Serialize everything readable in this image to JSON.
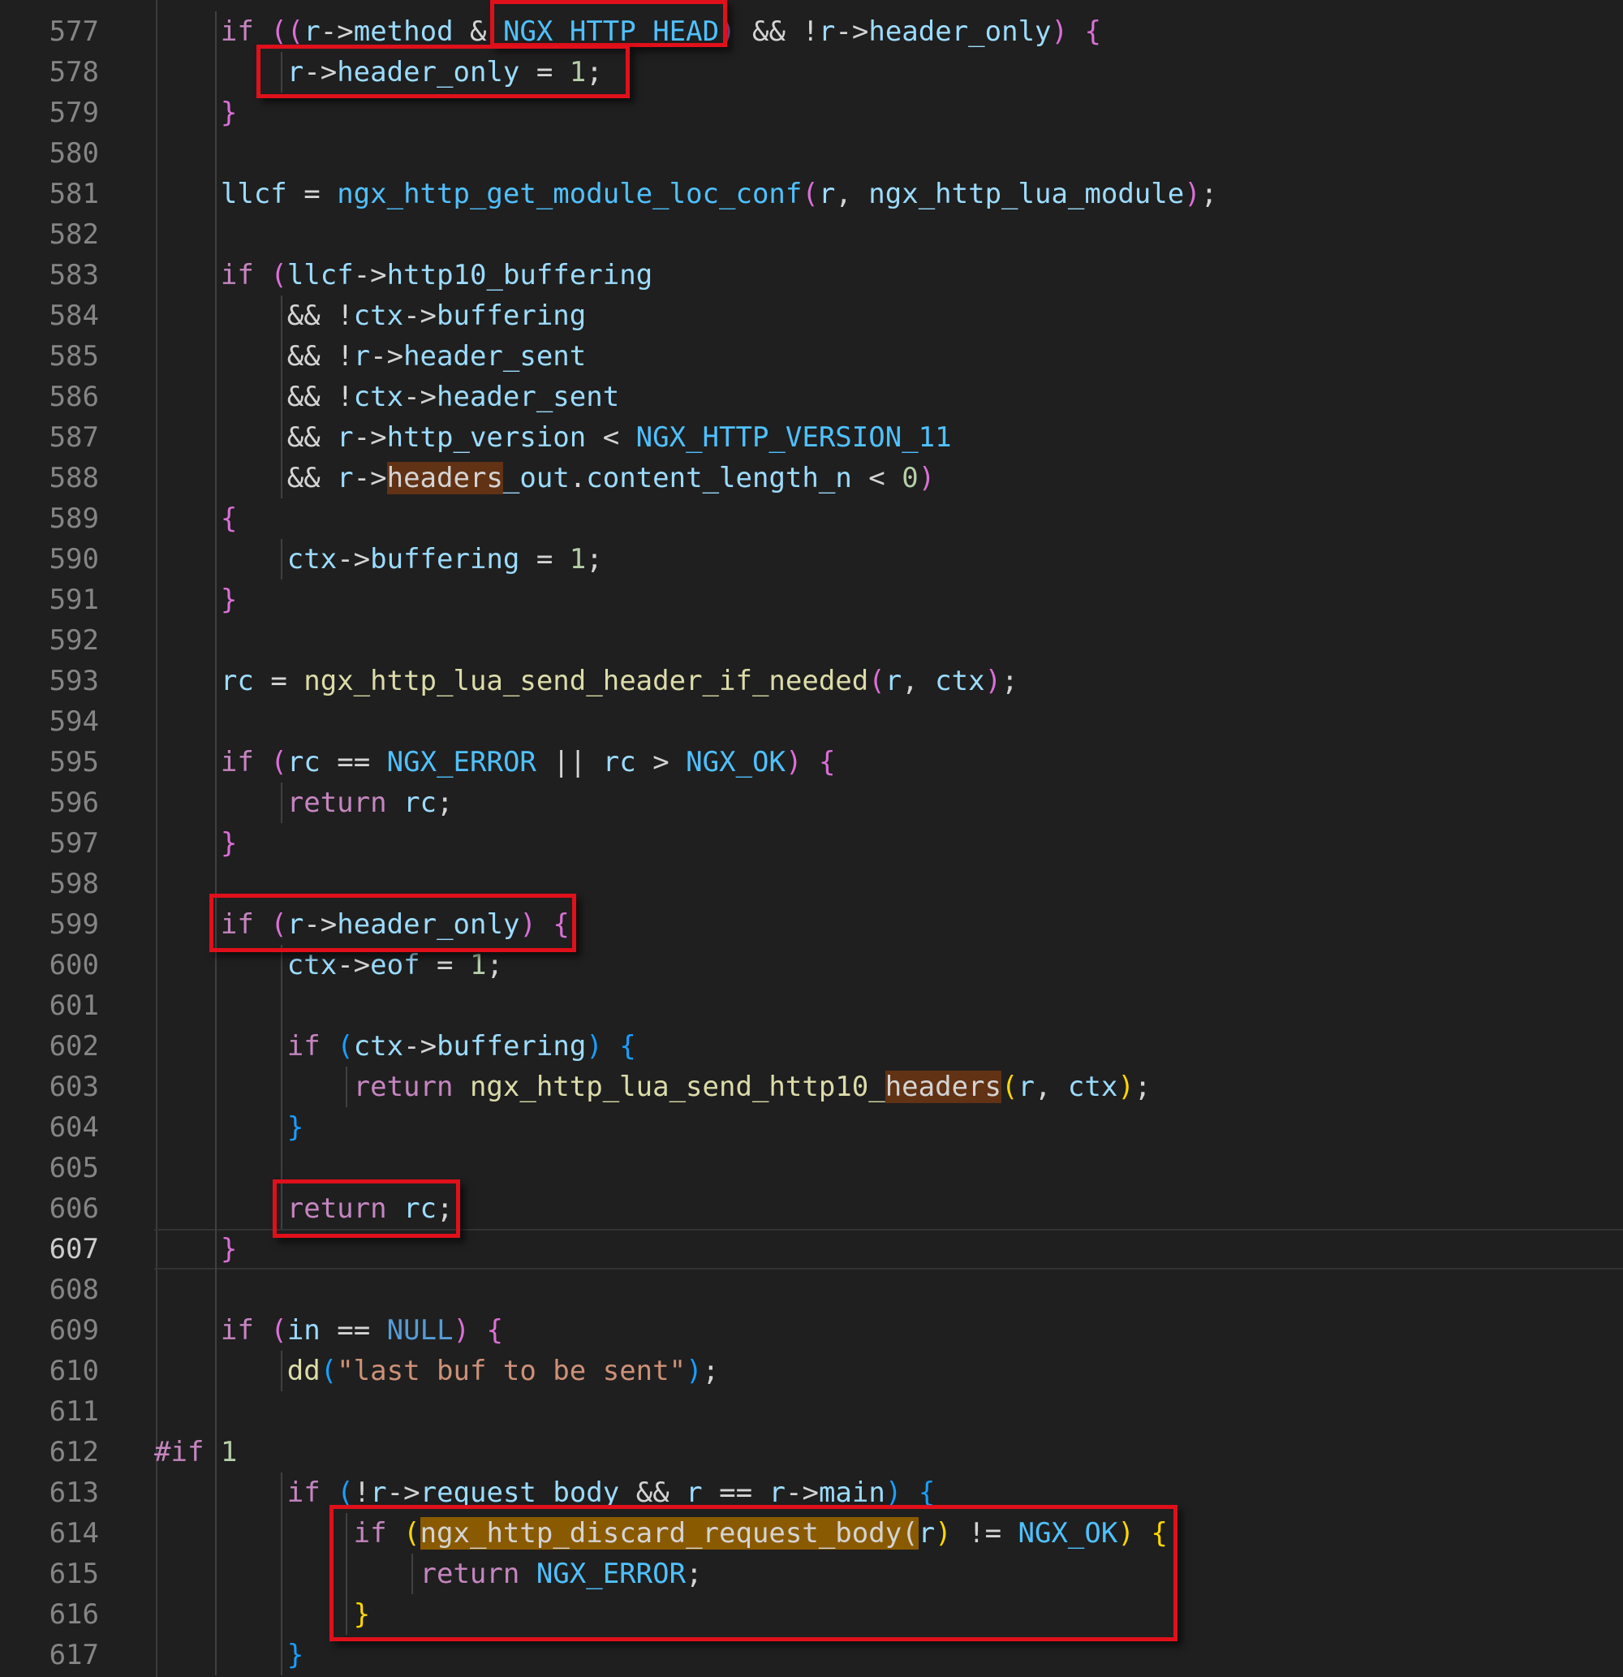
{
  "editor": {
    "language": "c",
    "active_line": "607",
    "lines": [
      {
        "n": "577",
        "tokens": [
          [
            "    ",
            ""
          ],
          [
            "if",
            "kw"
          ],
          [
            " ",
            ""
          ],
          [
            "((",
            "p1"
          ],
          [
            "r",
            "var"
          ],
          [
            "->",
            "op"
          ],
          [
            "method",
            "var"
          ],
          [
            " & ",
            ""
          ],
          [
            "NGX_HTTP_HEAD",
            "mac"
          ],
          [
            ")",
            "p1"
          ],
          [
            " && !",
            ""
          ],
          [
            "r",
            "var"
          ],
          [
            "->",
            "op"
          ],
          [
            "header_only",
            "var"
          ],
          [
            ")",
            "p1"
          ],
          [
            " ",
            ""
          ],
          [
            "{",
            "p1"
          ]
        ]
      },
      {
        "n": "578",
        "tokens": [
          [
            "        ",
            ""
          ],
          [
            "r",
            "var"
          ],
          [
            "->",
            "op"
          ],
          [
            "header_only",
            "var"
          ],
          [
            " = ",
            ""
          ],
          [
            "1",
            "num"
          ],
          [
            ";",
            ""
          ]
        ]
      },
      {
        "n": "579",
        "tokens": [
          [
            "    ",
            ""
          ],
          [
            "}",
            "p1"
          ]
        ]
      },
      {
        "n": "580",
        "tokens": []
      },
      {
        "n": "581",
        "tokens": [
          [
            "    ",
            ""
          ],
          [
            "llcf",
            "var"
          ],
          [
            " = ",
            ""
          ],
          [
            "ngx_http_get_module_loc_conf",
            "mac"
          ],
          [
            "(",
            "p1"
          ],
          [
            "r",
            "var"
          ],
          [
            ", ",
            ""
          ],
          [
            "ngx_http_lua_module",
            "var"
          ],
          [
            ")",
            "p1"
          ],
          [
            ";",
            ""
          ]
        ]
      },
      {
        "n": "582",
        "tokens": []
      },
      {
        "n": "583",
        "tokens": [
          [
            "    ",
            ""
          ],
          [
            "if",
            "kw"
          ],
          [
            " ",
            ""
          ],
          [
            "(",
            "p1"
          ],
          [
            "llcf",
            "var"
          ],
          [
            "->",
            "op"
          ],
          [
            "http10_buffering",
            "var"
          ]
        ]
      },
      {
        "n": "584",
        "tokens": [
          [
            "        && !",
            ""
          ],
          [
            "ctx",
            "var"
          ],
          [
            "->",
            "op"
          ],
          [
            "buffering",
            "var"
          ]
        ]
      },
      {
        "n": "585",
        "tokens": [
          [
            "        && !",
            ""
          ],
          [
            "r",
            "var"
          ],
          [
            "->",
            "op"
          ],
          [
            "header_sent",
            "var"
          ]
        ]
      },
      {
        "n": "586",
        "tokens": [
          [
            "        && !",
            ""
          ],
          [
            "ctx",
            "var"
          ],
          [
            "->",
            "op"
          ],
          [
            "header_sent",
            "var"
          ]
        ]
      },
      {
        "n": "587",
        "tokens": [
          [
            "        && ",
            ""
          ],
          [
            "r",
            "var"
          ],
          [
            "->",
            "op"
          ],
          [
            "http_version",
            "var"
          ],
          [
            " < ",
            ""
          ],
          [
            "NGX_HTTP_VERSION_11",
            "mac"
          ]
        ]
      },
      {
        "n": "588",
        "tokens": [
          [
            "        && ",
            ""
          ],
          [
            "r",
            "var"
          ],
          [
            "->",
            "op"
          ],
          [
            "headers",
            "mark"
          ],
          [
            "_out",
            "var"
          ],
          [
            ".",
            ""
          ],
          [
            "content_length_n",
            "var"
          ],
          [
            " < ",
            ""
          ],
          [
            "0",
            "num"
          ],
          [
            ")",
            "p1"
          ]
        ]
      },
      {
        "n": "589",
        "tokens": [
          [
            "    ",
            ""
          ],
          [
            "{",
            "p1"
          ]
        ]
      },
      {
        "n": "590",
        "tokens": [
          [
            "        ",
            ""
          ],
          [
            "ctx",
            "var"
          ],
          [
            "->",
            "op"
          ],
          [
            "buffering",
            "var"
          ],
          [
            " = ",
            ""
          ],
          [
            "1",
            "num"
          ],
          [
            ";",
            ""
          ]
        ]
      },
      {
        "n": "591",
        "tokens": [
          [
            "    ",
            ""
          ],
          [
            "}",
            "p1"
          ]
        ]
      },
      {
        "n": "592",
        "tokens": []
      },
      {
        "n": "593",
        "tokens": [
          [
            "    ",
            ""
          ],
          [
            "rc",
            "var"
          ],
          [
            " = ",
            ""
          ],
          [
            "ngx_http_lua_send_header_if_needed",
            "fn"
          ],
          [
            "(",
            "p1"
          ],
          [
            "r",
            "var"
          ],
          [
            ", ",
            ""
          ],
          [
            "ctx",
            "var"
          ],
          [
            ")",
            "p1"
          ],
          [
            ";",
            ""
          ]
        ]
      },
      {
        "n": "594",
        "tokens": []
      },
      {
        "n": "595",
        "tokens": [
          [
            "    ",
            ""
          ],
          [
            "if",
            "kw"
          ],
          [
            " ",
            ""
          ],
          [
            "(",
            "p1"
          ],
          [
            "rc",
            "var"
          ],
          [
            " == ",
            ""
          ],
          [
            "NGX_ERROR",
            "mac"
          ],
          [
            " || ",
            ""
          ],
          [
            "rc",
            "var"
          ],
          [
            " > ",
            ""
          ],
          [
            "NGX_OK",
            "mac"
          ],
          [
            ")",
            "p1"
          ],
          [
            " ",
            ""
          ],
          [
            "{",
            "p1"
          ]
        ]
      },
      {
        "n": "596",
        "tokens": [
          [
            "        ",
            ""
          ],
          [
            "return",
            "kw"
          ],
          [
            " ",
            ""
          ],
          [
            "rc",
            "var"
          ],
          [
            ";",
            ""
          ]
        ]
      },
      {
        "n": "597",
        "tokens": [
          [
            "    ",
            ""
          ],
          [
            "}",
            "p1"
          ]
        ]
      },
      {
        "n": "598",
        "tokens": []
      },
      {
        "n": "599",
        "tokens": [
          [
            "    ",
            ""
          ],
          [
            "if",
            "kw"
          ],
          [
            " ",
            ""
          ],
          [
            "(",
            "p1"
          ],
          [
            "r",
            "var"
          ],
          [
            "->",
            "op"
          ],
          [
            "header_only",
            "var"
          ],
          [
            ")",
            "p1"
          ],
          [
            " ",
            ""
          ],
          [
            "{",
            "p1"
          ]
        ]
      },
      {
        "n": "600",
        "tokens": [
          [
            "        ",
            ""
          ],
          [
            "ctx",
            "var"
          ],
          [
            "->",
            "op"
          ],
          [
            "eof",
            "var"
          ],
          [
            " = ",
            ""
          ],
          [
            "1",
            "num"
          ],
          [
            ";",
            ""
          ]
        ]
      },
      {
        "n": "601",
        "tokens": []
      },
      {
        "n": "602",
        "tokens": [
          [
            "        ",
            ""
          ],
          [
            "if",
            "kw"
          ],
          [
            " ",
            ""
          ],
          [
            "(",
            "p2"
          ],
          [
            "ctx",
            "var"
          ],
          [
            "->",
            "op"
          ],
          [
            "buffering",
            "var"
          ],
          [
            ")",
            "p2"
          ],
          [
            " ",
            ""
          ],
          [
            "{",
            "p2"
          ]
        ]
      },
      {
        "n": "603",
        "tokens": [
          [
            "            ",
            ""
          ],
          [
            "return",
            "kw"
          ],
          [
            " ",
            ""
          ],
          [
            "ngx_http_lua_send_http10_",
            "fn"
          ],
          [
            "headers",
            "mark"
          ],
          [
            "(",
            "p3"
          ],
          [
            "r",
            "var"
          ],
          [
            ", ",
            ""
          ],
          [
            "ctx",
            "var"
          ],
          [
            ")",
            "p3"
          ],
          [
            ";",
            ""
          ]
        ]
      },
      {
        "n": "604",
        "tokens": [
          [
            "        ",
            ""
          ],
          [
            "}",
            "p2"
          ]
        ]
      },
      {
        "n": "605",
        "tokens": []
      },
      {
        "n": "606",
        "tokens": [
          [
            "        ",
            ""
          ],
          [
            "return",
            "kw"
          ],
          [
            " ",
            ""
          ],
          [
            "rc",
            "var"
          ],
          [
            ";",
            ""
          ]
        ]
      },
      {
        "n": "607",
        "tokens": [
          [
            "    ",
            ""
          ],
          [
            "}",
            "p1"
          ]
        ]
      },
      {
        "n": "608",
        "tokens": []
      },
      {
        "n": "609",
        "tokens": [
          [
            "    ",
            ""
          ],
          [
            "if",
            "kw"
          ],
          [
            " ",
            ""
          ],
          [
            "(",
            "p1"
          ],
          [
            "in",
            "var"
          ],
          [
            " == ",
            ""
          ],
          [
            "NULL",
            "ty"
          ],
          [
            ")",
            "p1"
          ],
          [
            " ",
            ""
          ],
          [
            "{",
            "p1"
          ]
        ]
      },
      {
        "n": "610",
        "tokens": [
          [
            "        ",
            ""
          ],
          [
            "dd",
            "fn"
          ],
          [
            "(",
            "p2"
          ],
          [
            "\"last buf to be sent\"",
            "str"
          ],
          [
            ")",
            "p2"
          ],
          [
            ";",
            ""
          ]
        ]
      },
      {
        "n": "611",
        "tokens": []
      },
      {
        "n": "612",
        "tokens": [
          [
            "#if",
            "kw"
          ],
          [
            " ",
            ""
          ],
          [
            "1",
            "num"
          ]
        ]
      },
      {
        "n": "613",
        "tokens": [
          [
            "        ",
            ""
          ],
          [
            "if",
            "kw"
          ],
          [
            " ",
            ""
          ],
          [
            "(",
            "p2"
          ],
          [
            "!",
            ""
          ],
          [
            "r",
            "var"
          ],
          [
            "->",
            "op"
          ],
          [
            "request_body",
            "var"
          ],
          [
            " && ",
            ""
          ],
          [
            "r",
            "var"
          ],
          [
            " == ",
            ""
          ],
          [
            "r",
            "var"
          ],
          [
            "->",
            "op"
          ],
          [
            "main",
            "var"
          ],
          [
            ")",
            "p2"
          ],
          [
            " ",
            ""
          ],
          [
            "{",
            "p2"
          ]
        ]
      },
      {
        "n": "614",
        "tokens": [
          [
            "            ",
            ""
          ],
          [
            "if",
            "kw"
          ],
          [
            " ",
            ""
          ],
          [
            "(",
            "p3"
          ],
          [
            "ngx_http_discard_request_body(",
            "mark2"
          ],
          [
            "r",
            "var"
          ],
          [
            ")",
            "p3"
          ],
          [
            " != ",
            ""
          ],
          [
            "NGX_OK",
            "mac"
          ],
          [
            ")",
            "p3"
          ],
          [
            " ",
            ""
          ],
          [
            "{",
            "p3"
          ]
        ]
      },
      {
        "n": "615",
        "tokens": [
          [
            "                ",
            ""
          ],
          [
            "return",
            "kw"
          ],
          [
            " ",
            ""
          ],
          [
            "NGX_ERROR",
            "mac"
          ],
          [
            ";",
            ""
          ]
        ]
      },
      {
        "n": "616",
        "tokens": [
          [
            "            ",
            ""
          ],
          [
            "}",
            "p3"
          ]
        ]
      },
      {
        "n": "617",
        "tokens": [
          [
            "        ",
            ""
          ],
          [
            "}",
            "p2"
          ]
        ]
      }
    ]
  }
}
